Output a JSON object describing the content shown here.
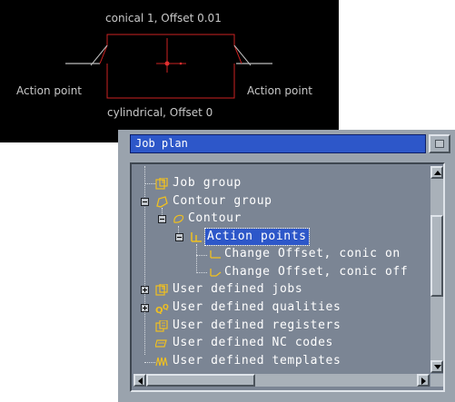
{
  "cad_view": {
    "top_label": "conical 1, Offset 0.01",
    "bottom_label": "cylindrical, Offset 0",
    "left_label": "Action point",
    "right_label": "Action point"
  },
  "window": {
    "title": "Job plan"
  },
  "tree": {
    "items": [
      {
        "label": "Job group",
        "icon": "job-group-icon",
        "expander": ""
      },
      {
        "label": "Contour group",
        "icon": "contour-group-icon",
        "expander": "minus"
      },
      {
        "label": "Contour",
        "icon": "contour-icon",
        "expander": "minus"
      },
      {
        "label": "Action points",
        "icon": "action-points-icon",
        "expander": "minus",
        "selected": true
      },
      {
        "label": "Change Offset, conic on",
        "icon": "action-point-on-icon",
        "expander": ""
      },
      {
        "label": "Change Offset, conic off",
        "icon": "action-point-off-icon",
        "expander": ""
      },
      {
        "label": "User defined jobs",
        "icon": "user-jobs-icon",
        "expander": "plus"
      },
      {
        "label": "User defined qualities",
        "icon": "user-qualities-icon",
        "expander": "plus"
      },
      {
        "label": "User defined registers",
        "icon": "user-registers-icon",
        "expander": ""
      },
      {
        "label": "User defined NC codes",
        "icon": "user-nc-codes-icon",
        "expander": ""
      },
      {
        "label": "User defined templates",
        "icon": "user-templates-icon",
        "expander": ""
      }
    ]
  },
  "colors": {
    "cad_background": "#000000",
    "cad_lines": "#c0c0c0",
    "cad_accent": "#e03030",
    "tree_background": "#7b8594",
    "titlebar": "#2d57c9",
    "icon_yellow": "#f0c020"
  }
}
